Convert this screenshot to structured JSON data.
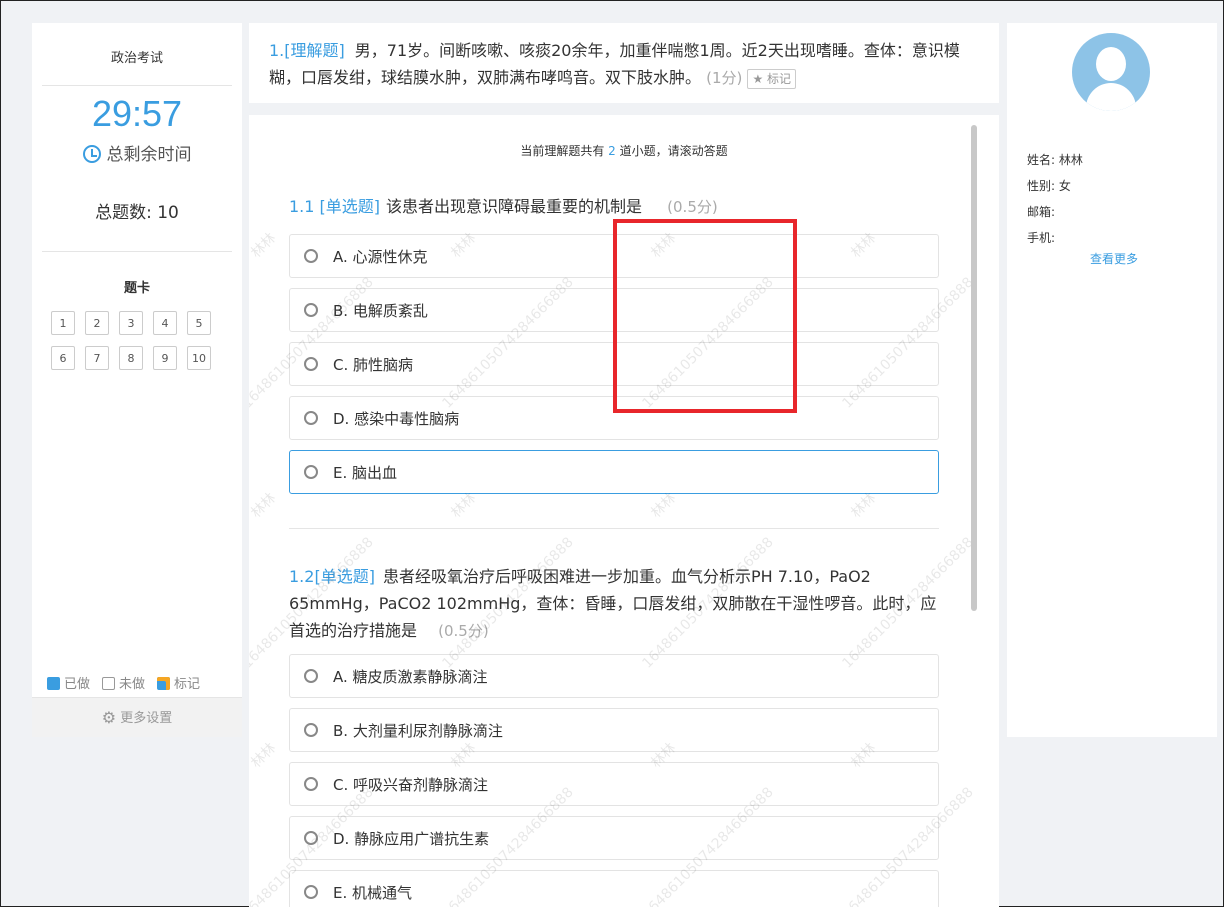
{
  "left": {
    "exam_title": "政治考试",
    "timer": "29:57",
    "timer_label": "总剩余时间",
    "total": "总题数: 10",
    "card_title": "题卡",
    "cards": [
      "1",
      "2",
      "3",
      "4",
      "5",
      "6",
      "7",
      "8",
      "9",
      "10"
    ],
    "legend": {
      "done": "已做",
      "undone": "未做",
      "marked": "标记"
    },
    "more_settings": "更多设置"
  },
  "header": {
    "number": "1.",
    "type": "[理解题]",
    "text": "男，71岁。间断咳嗽、咳痰20余年，加重伴喘憋1周。近2天出现嗜睡。查体：意识模糊，口唇发绀，球结膜水肿，双肺满布哮鸣音。双下肢水肿。",
    "score": "(1分)",
    "mark": "标记"
  },
  "main": {
    "note_prefix": "当前理解题共有",
    "note_count": "2",
    "note_suffix": "道小题，请滚动答题",
    "q1": {
      "number": "1.1",
      "type": "[单选题]",
      "text": "该患者出现意识障碍最重要的机制是",
      "score": "(0.5分)",
      "options": [
        "A. 心源性休克",
        "B. 电解质紊乱",
        "C. 肺性脑病",
        "D. 感染中毒性脑病",
        "E. 脑出血"
      ]
    },
    "q2": {
      "number": "1.2",
      "type": "[单选题]",
      "text": "患者经吸氧治疗后呼吸困难进一步加重。血气分析示PH 7.10，PaO2 65mmHg，PaCO2 102mmHg，查体：昏睡，口唇发绀，双肺散在干湿性啰音。此时，应首选的治疗措施是",
      "score": "(0.5分)",
      "options": [
        "A. 糖皮质激素静脉滴注",
        "B. 大剂量利尿剂静脉滴注",
        "C. 呼吸兴奋剂静脉滴注",
        "D. 静脉应用广谱抗生素",
        "E. 机械通气"
      ]
    },
    "watermark_name": "林林",
    "watermark_number": "16486105074284666888"
  },
  "profile": {
    "name_label": "姓名:",
    "name_value": "林林",
    "gender_label": "性别:",
    "gender_value": "女",
    "email_label": "邮箱:",
    "phone_label": "手机:",
    "more": "查看更多"
  },
  "colors": {
    "accent": "#3a9de0",
    "highlight": "#e8262b"
  }
}
